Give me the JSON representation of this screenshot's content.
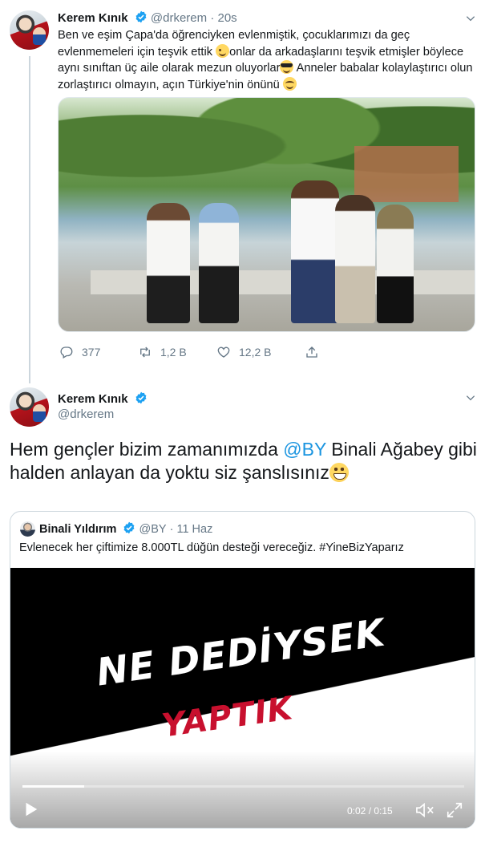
{
  "tweet": {
    "author_name": "Kerem Kınık",
    "author_handle": "@drkerem",
    "time": "· 20s",
    "text_parts": [
      "Ben ve eşim Çapa'da öğrenciyken evlenmiştik, çocuklarımızı da geç evlenmemeleri için teşvik ettik ",
      "onlar da arkadaşlarını teşvik etmişler böylece aynı sınıftan üç aile olarak mezun oluyorlar",
      " Anneler babalar kolaylaştırıcı olun zorlaştırıcı olmayın, açın Türkiye'nin önünü "
    ],
    "emojis": [
      "winking-face",
      "smiling-face-sunglasses",
      "smiling-face-blush"
    ],
    "stats": {
      "replies": "377",
      "retweets": "1,2 B",
      "likes": "12,2 B"
    }
  },
  "reply": {
    "author_name": "Kerem Kınık",
    "author_handle": "@drkerem",
    "text_before": "Hem gençler bizim zamanımızda ",
    "mention": "@BY",
    "text_after": " Binali Ağabey gibi halden anlayan da yoktu siz şanslısınız",
    "emoji": "grinning-face"
  },
  "quote": {
    "author_name": "Binali Yıldırım",
    "author_handle": "@BY",
    "date": "· 11 Haz",
    "text": "Evlenecek her çiftimize 8.000TL düğün desteği vereceğiz. #YineBizYaparız",
    "video": {
      "title_line1": "NE DEDİYSEK",
      "title_line2": "YAPTIK",
      "time": "0:02 / 0:15",
      "progress": 0.14,
      "title_colors": {
        "line1": "#ffffff",
        "line2": "#c8102e"
      }
    }
  },
  "colors": {
    "verified": "#1da1f2",
    "link": "#1b95e0",
    "muted": "#657786"
  }
}
